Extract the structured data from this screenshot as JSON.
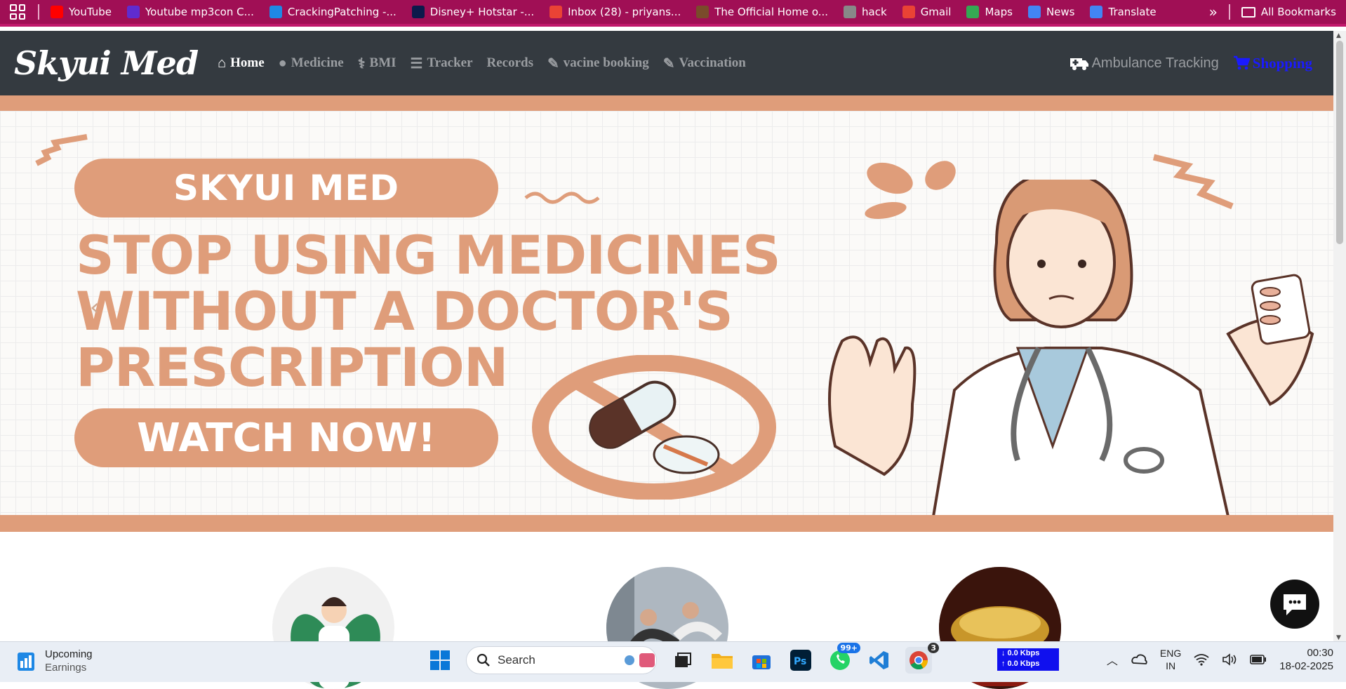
{
  "bookmarks": {
    "items": [
      {
        "label": "YouTube",
        "color": "#ff0000"
      },
      {
        "label": "Youtube mp3con C...",
        "color": "#5f2ccf"
      },
      {
        "label": "CrackingPatching -...",
        "color": "#1e88e5"
      },
      {
        "label": "Disney+ Hotstar -...",
        "color": "#0c1a4b"
      },
      {
        "label": "Inbox (28) - priyans...",
        "color": "#ea4335"
      },
      {
        "label": "The Official Home o...",
        "color": "#7a4b2b"
      },
      {
        "label": "hack",
        "color": "#888888"
      },
      {
        "label": "Gmail",
        "color": "#ea4335"
      },
      {
        "label": "Maps",
        "color": "#34a853"
      },
      {
        "label": "News",
        "color": "#4285f4"
      },
      {
        "label": "Translate",
        "color": "#4285f4"
      }
    ],
    "more": "»",
    "all_bookmarks": "All Bookmarks"
  },
  "navbar": {
    "brand": "Skyui Med",
    "links": [
      {
        "label": "Home",
        "icon": "home-icon",
        "active": true
      },
      {
        "label": "Medicine",
        "icon": "user-icon"
      },
      {
        "label": "BMI",
        "icon": "stethoscope-icon"
      },
      {
        "label": "Tracker",
        "icon": "list-icon"
      },
      {
        "label": "Records",
        "icon": ""
      },
      {
        "label": "vacine booking",
        "icon": "syringe-icon"
      },
      {
        "label": "Vaccination",
        "icon": "syringe-icon"
      }
    ],
    "ambulance": "Ambulance Tracking",
    "shopping": "Shopping"
  },
  "banner": {
    "top_pill": "SKYUI MED",
    "headline_1": "STOP USING MEDICINES",
    "headline_2": "WITHOUT A DOCTOR'S",
    "headline_3": "PRESCRIPTION",
    "bottom_pill": "WATCH NOW!",
    "prev": "‹",
    "accent": "#df9d7a"
  },
  "taskbar": {
    "widget_title": "Upcoming",
    "widget_sub": "Earnings",
    "search_placeholder": "Search",
    "whatsapp_badge": "99+",
    "chrome_badge": "3",
    "net_down": "↓ 0.0 Kbps",
    "net_up": "↑ 0.0 Kbps",
    "lang_1": "ENG",
    "lang_2": "IN",
    "time": "00:30",
    "date": "18-02-2025"
  }
}
